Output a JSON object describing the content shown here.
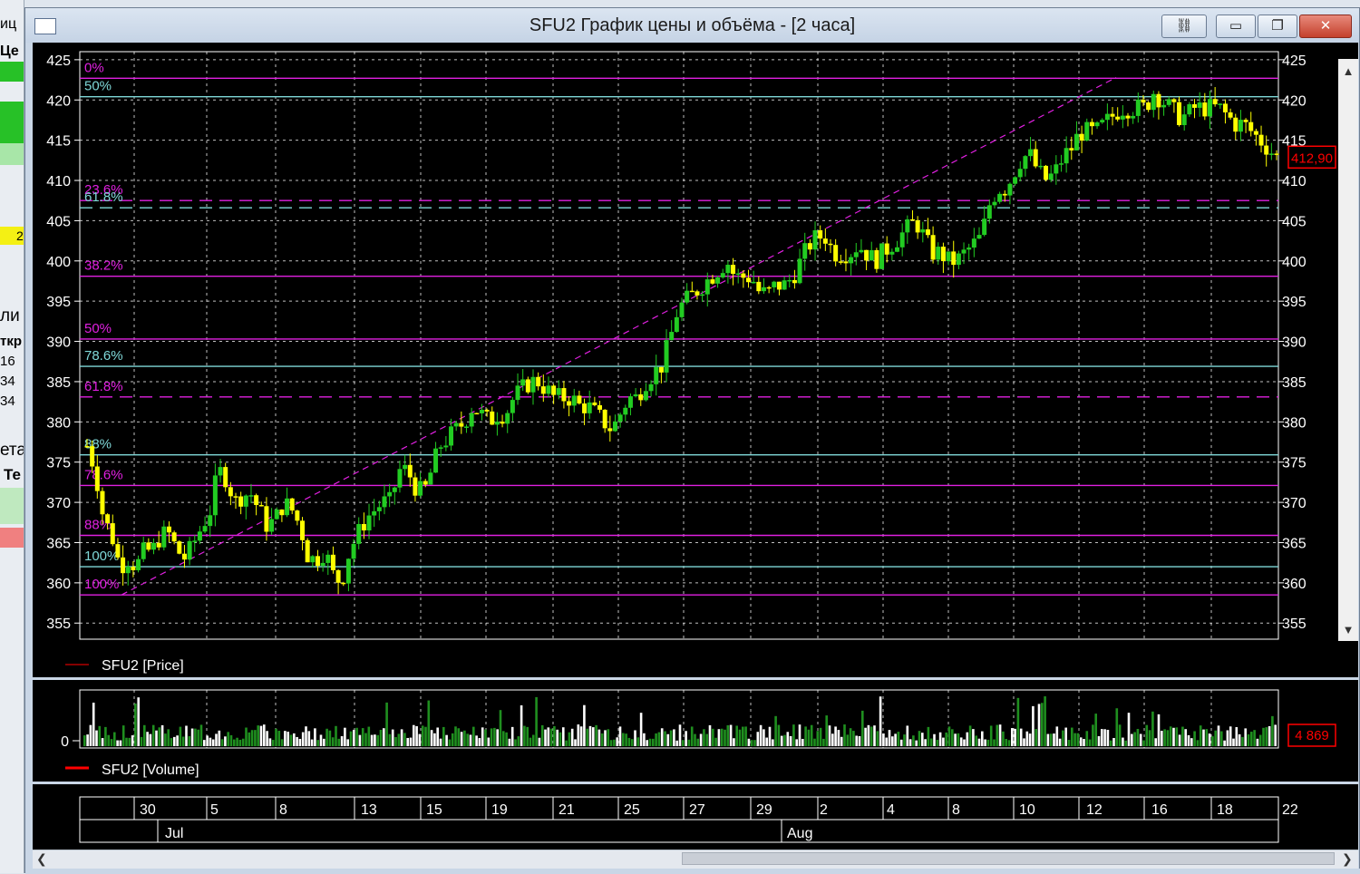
{
  "window": {
    "title": "SFU2 График цены и объёма - [2 часа]"
  },
  "left_panel": {
    "fragments": [
      "иц",
      "Це",
      "2",
      "ли",
      "ткр",
      "16",
      "34",
      "34",
      "ета",
      "Те"
    ]
  },
  "colors": {
    "background": "#000000",
    "grid": "#ffffff",
    "candle_up": "#22cc22",
    "candle_down": "#ffff00",
    "fib_magenta": "#e020e0",
    "fib_cyan": "#7fd8d8",
    "price_tag": "#ff0000",
    "volume_up": "#1f8f1f",
    "volume_down": "#ffffff"
  },
  "chart_data": [
    {
      "type": "candlestick",
      "series": [
        {
          "name": "SFU2 [Price]"
        }
      ],
      "y_range": [
        353,
        426
      ],
      "y_ticks": [
        425,
        420,
        415,
        410,
        405,
        400,
        395,
        390,
        385,
        380,
        375,
        370,
        365,
        360,
        355
      ],
      "last_price_label": "412,90",
      "last_price": 412.9,
      "grid": true,
      "fibonacci_levels": [
        {
          "label": "0%",
          "price": 422.7,
          "color": "magenta",
          "style": "solid"
        },
        {
          "label": "50%",
          "price": 420.4,
          "color": "cyan",
          "style": "solid"
        },
        {
          "label": "23.6%",
          "price": 407.5,
          "color": "magenta",
          "style": "dashed"
        },
        {
          "label": "61.8%",
          "price": 406.6,
          "color": "cyan",
          "style": "dashed"
        },
        {
          "label": "38.2%",
          "price": 398.1,
          "color": "magenta",
          "style": "solid"
        },
        {
          "label": "50%",
          "price": 390.3,
          "color": "magenta",
          "style": "solid"
        },
        {
          "label": "78.6%",
          "price": 386.9,
          "color": "cyan",
          "style": "solid"
        },
        {
          "label": "61.8%",
          "price": 383.1,
          "color": "magenta",
          "style": "dashed"
        },
        {
          "label": "88%",
          "price": 375.9,
          "color": "cyan",
          "style": "solid"
        },
        {
          "label": "78.6%",
          "price": 372.1,
          "color": "magenta",
          "style": "solid"
        },
        {
          "label": "88%",
          "price": 365.9,
          "color": "magenta",
          "style": "solid"
        },
        {
          "label": "100%",
          "price": 362.0,
          "color": "cyan",
          "style": "solid"
        },
        {
          "label": "100%",
          "price": 358.5,
          "color": "magenta",
          "style": "solid"
        }
      ],
      "trendline": {
        "start_price": 358.5,
        "end_price": 422.8,
        "style": "dashed",
        "color": "magenta"
      },
      "price_path": [
        [
          0,
          377
        ],
        [
          4,
          374
        ],
        [
          8,
          368
        ],
        [
          12,
          366
        ],
        [
          16,
          362
        ],
        [
          20,
          363
        ],
        [
          24,
          362
        ],
        [
          28,
          364
        ],
        [
          32,
          364
        ],
        [
          36,
          366
        ],
        [
          40,
          366
        ],
        [
          44,
          364
        ],
        [
          48,
          363
        ],
        [
          52,
          365
        ],
        [
          56,
          367
        ],
        [
          60,
          369
        ],
        [
          64,
          374
        ],
        [
          68,
          373
        ],
        [
          72,
          370
        ],
        [
          76,
          371
        ],
        [
          80,
          371
        ],
        [
          84,
          369
        ],
        [
          88,
          367
        ],
        [
          92,
          368
        ],
        [
          96,
          370
        ],
        [
          100,
          369
        ],
        [
          104,
          367
        ],
        [
          108,
          363
        ],
        [
          112,
          363
        ],
        [
          116,
          364
        ],
        [
          120,
          361
        ],
        [
          124,
          360
        ],
        [
          128,
          364
        ],
        [
          132,
          366
        ],
        [
          136,
          368
        ],
        [
          140,
          369
        ],
        [
          144,
          370
        ],
        [
          148,
          370
        ],
        [
          152,
          374
        ],
        [
          156,
          374
        ],
        [
          160,
          372
        ],
        [
          164,
          371
        ],
        [
          168,
          374
        ],
        [
          172,
          377
        ],
        [
          176,
          378
        ],
        [
          180,
          379
        ],
        [
          184,
          380
        ],
        [
          188,
          382
        ],
        [
          192,
          381
        ],
        [
          196,
          380
        ],
        [
          200,
          381
        ],
        [
          204,
          381
        ],
        [
          208,
          383
        ],
        [
          212,
          384
        ],
        [
          216,
          385
        ],
        [
          220,
          385
        ],
        [
          224,
          384
        ],
        [
          228,
          383
        ],
        [
          232,
          383
        ],
        [
          236,
          383
        ],
        [
          240,
          382
        ],
        [
          244,
          382
        ],
        [
          248,
          381
        ],
        [
          252,
          380
        ],
        [
          256,
          379
        ],
        [
          260,
          381
        ],
        [
          264,
          383
        ],
        [
          268,
          383
        ],
        [
          272,
          385
        ],
        [
          276,
          386
        ],
        [
          280,
          387
        ],
        [
          284,
          390
        ],
        [
          288,
          394
        ],
        [
          292,
          395
        ],
        [
          296,
          396
        ],
        [
          300,
          397
        ],
        [
          304,
          398
        ],
        [
          308,
          399
        ],
        [
          312,
          400
        ],
        [
          316,
          398
        ],
        [
          320,
          398
        ],
        [
          324,
          398
        ],
        [
          328,
          396
        ],
        [
          332,
          396
        ],
        [
          336,
          397
        ],
        [
          340,
          397
        ],
        [
          344,
          398
        ],
        [
          348,
          400
        ],
        [
          352,
          402
        ],
        [
          356,
          403
        ],
        [
          360,
          403
        ],
        [
          364,
          401
        ],
        [
          368,
          401
        ],
        [
          372,
          401
        ],
        [
          376,
          402
        ],
        [
          380,
          401
        ],
        [
          384,
          400
        ],
        [
          388,
          401
        ],
        [
          392,
          402
        ],
        [
          396,
          403
        ],
        [
          400,
          404
        ],
        [
          404,
          405
        ],
        [
          408,
          403
        ],
        [
          412,
          401
        ],
        [
          416,
          401
        ],
        [
          420,
          400
        ],
        [
          424,
          400
        ],
        [
          428,
          401
        ],
        [
          432,
          402
        ],
        [
          436,
          403
        ],
        [
          440,
          407
        ],
        [
          444,
          409
        ],
        [
          448,
          409
        ],
        [
          452,
          411
        ],
        [
          456,
          413
        ],
        [
          460,
          413
        ],
        [
          464,
          411
        ],
        [
          468,
          410
        ],
        [
          472,
          411
        ],
        [
          476,
          413
        ],
        [
          480,
          414
        ],
        [
          484,
          416
        ],
        [
          488,
          416
        ],
        [
          492,
          416
        ],
        [
          496,
          417
        ],
        [
          500,
          418
        ],
        [
          504,
          419
        ],
        [
          508,
          419
        ],
        [
          512,
          419
        ],
        [
          516,
          419
        ],
        [
          520,
          421
        ],
        [
          524,
          420
        ],
        [
          528,
          419
        ],
        [
          532,
          418
        ],
        [
          536,
          418
        ],
        [
          540,
          419
        ],
        [
          544,
          419
        ],
        [
          548,
          419
        ],
        [
          552,
          419
        ],
        [
          556,
          418
        ],
        [
          560,
          417
        ],
        [
          564,
          417
        ],
        [
          568,
          416
        ],
        [
          572,
          415
        ],
        [
          576,
          414
        ],
        [
          580,
          412.9
        ]
      ]
    },
    {
      "type": "bar",
      "series": [
        {
          "name": "SFU2 [Volume]"
        }
      ],
      "y_ticks": [
        0
      ],
      "last_volume_label": "4 869",
      "last_volume": 4869,
      "grid": true
    }
  ],
  "x_axis": {
    "day_labels": [
      "30",
      "5",
      "8",
      "13",
      "15",
      "19",
      "21",
      "25",
      "27",
      "29",
      "2",
      "4",
      "8",
      "10",
      "12",
      "16",
      "18",
      "22"
    ],
    "month_labels": [
      "Jul",
      "Aug"
    ]
  }
}
